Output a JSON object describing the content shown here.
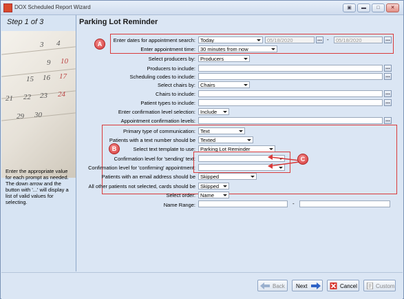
{
  "window": {
    "title": "DOX Scheduled Report Wizard",
    "controls": [
      "restore",
      "minimize",
      "maximize",
      "close"
    ]
  },
  "left_panel": {
    "step": "Step 1 of 3",
    "calendar_numbers": [
      "3",
      "4",
      "9",
      "10",
      "15",
      "16",
      "17",
      "21",
      "22",
      "23",
      "24",
      "29",
      "30"
    ],
    "help_text": "Enter the appropriate value for each prompt as needed. The down arrow and the button with '...' will display a list of valid values for selecting."
  },
  "form": {
    "heading": "Parking Lot Reminder",
    "dates_label": "Enter dates for appointment search:",
    "dates_mode": "Today",
    "date_from": "05/18/2020",
    "date_sep": "-",
    "date_to": "05/18/2020",
    "ellipsis": "...",
    "appt_time_label": "Enter appointment time:",
    "appt_time": "30 minutes from now",
    "producers_by_label": "Select producers by:",
    "producers_by": "Producers",
    "producers_label": "Producers to include:",
    "sched_codes_label": "Scheduling codes to include:",
    "chairs_by_label": "Select chairs by:",
    "chairs_by": "Chairs",
    "chairs_label": "Chairs to include:",
    "patient_types_label": "Patient types to include:",
    "confirm_sel_label": "Enter confirmation level selection:",
    "confirm_sel": "Include",
    "appt_confirm_label": "Appointment confirmation levels:",
    "primary_comm_label": "Primary type of communication:",
    "primary_comm": "Text",
    "text_number_label": "Patients with a text number should be",
    "text_number": "Texted",
    "template_label": "Select text template to use:",
    "template": "Parking Lot Reminder",
    "sending_label": "Confirmation level for 'sending' text:",
    "sending": "",
    "confirming_label": "Confirmation level for 'confirming' appointment:",
    "confirming": "",
    "email_label": "Patients with an email address should be",
    "email": "Skipped",
    "others_label": "All other patients not selected, cards should be",
    "others": "Skipped",
    "order_label": "Select order:",
    "order": "Name",
    "name_range_label": "Name Range:",
    "name_from": "",
    "name_sep": "-",
    "name_to": ""
  },
  "annotations": {
    "a": "A",
    "b": "B",
    "c": "C",
    "color": "#d93a3a"
  },
  "buttons": {
    "back": "Back",
    "next": "Next",
    "cancel": "Cancel",
    "custom": "Custom"
  }
}
